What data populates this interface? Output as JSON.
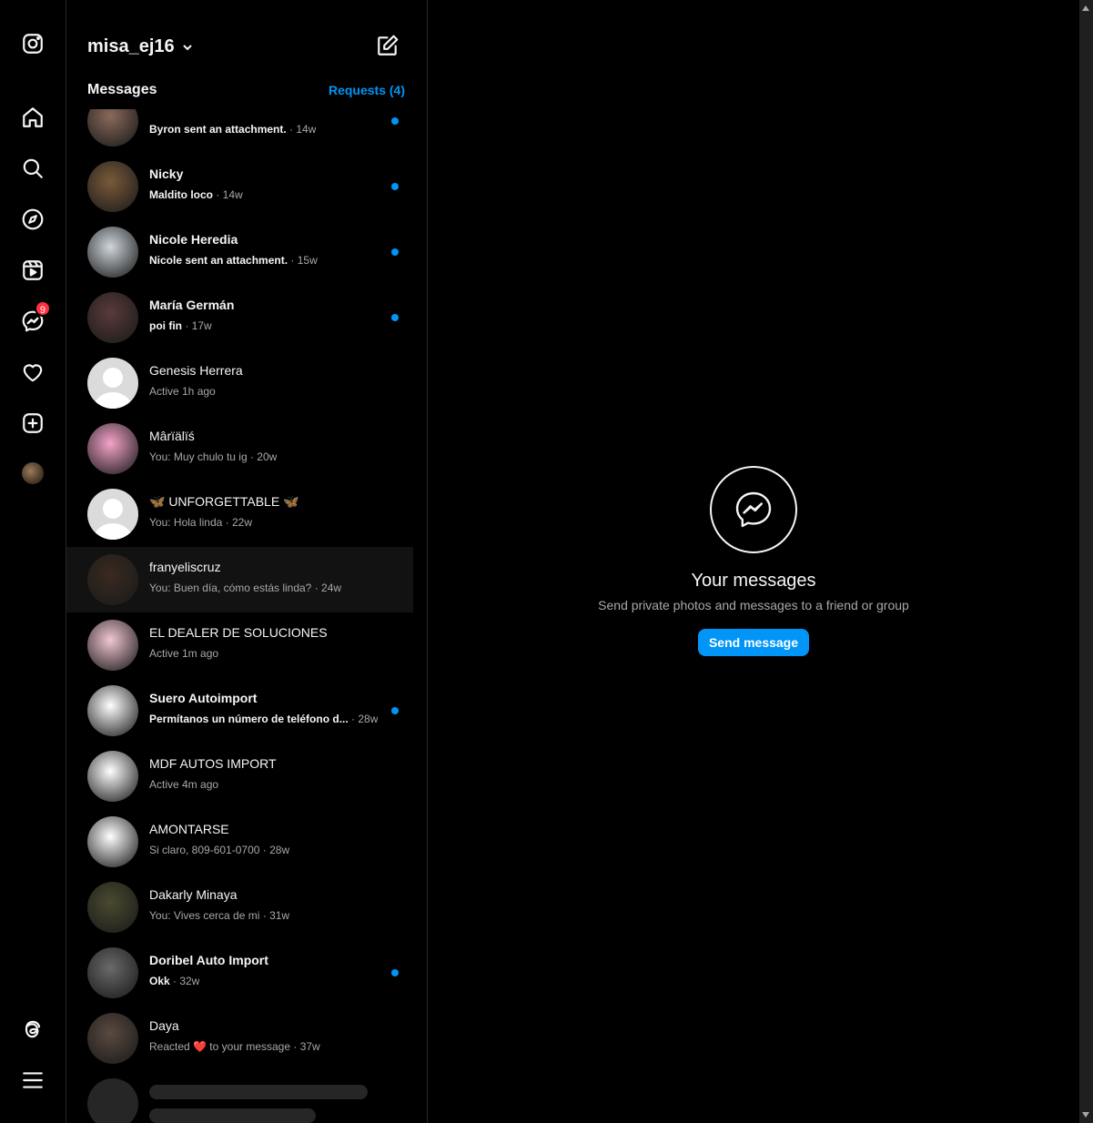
{
  "header": {
    "account_name": "misa_ej16",
    "messages_label": "Messages",
    "requests_label": "Requests (4)"
  },
  "nav": {
    "notification_badge": "9",
    "items": [
      "instagram-logo",
      "home",
      "search",
      "explore",
      "reels",
      "messenger",
      "notifications",
      "create",
      "profile",
      "threads",
      "more"
    ]
  },
  "conversations": [
    {
      "name": "",
      "preview": "Byron sent an attachment.",
      "time": "14w",
      "unread": true,
      "avatar": "#8a6a5a"
    },
    {
      "name": "Nicky",
      "preview": "Maldito loco",
      "time": "14w",
      "unread": true,
      "avatar": "#7a5a3a"
    },
    {
      "name": "Nicole Heredia",
      "preview": "Nicole sent an attachment.",
      "time": "15w",
      "unread": true,
      "avatar": "#cfd6dc"
    },
    {
      "name": "María Germán",
      "preview": "poi fin",
      "time": "17w",
      "unread": true,
      "avatar": "#5a3a3a"
    },
    {
      "name": "Genesis Herrera",
      "preview": "Active 1h ago",
      "time": "",
      "unread": false,
      "avatar": "default"
    },
    {
      "name": "Mârïälïś",
      "preview": "You: Muy chulo tu ig",
      "time": "20w",
      "unread": false,
      "avatar": "#f4a3c9"
    },
    {
      "name": "🦋 UNFORGETTABLE 🦋",
      "preview": "You: Hola linda",
      "time": "22w",
      "unread": false,
      "avatar": "default"
    },
    {
      "name": "franyeliscruz",
      "preview": "You: Buen día, cómo estás linda?",
      "time": "24w",
      "unread": false,
      "avatar": "#3a2a20",
      "selected": true
    },
    {
      "name": "EL DEALER DE SOLUCIONES",
      "preview": "Active 1m ago",
      "time": "",
      "unread": false,
      "avatar": "#f2c6d2"
    },
    {
      "name": "Suero Autoimport",
      "preview": "Permítanos un número de teléfono d...",
      "time": "28w",
      "unread": true,
      "avatar": "#ffffff"
    },
    {
      "name": "MDF AUTOS IMPORT",
      "preview": "Active 4m ago",
      "time": "",
      "unread": false,
      "avatar": "#ffffff"
    },
    {
      "name": "AMONTARSE",
      "preview": "Si claro, 809-601-0700",
      "time": "28w",
      "unread": false,
      "avatar": "#ffffff"
    },
    {
      "name": "Dakarly Minaya",
      "preview": "You: Vives cerca de mi",
      "time": "31w",
      "unread": false,
      "avatar": "#4a4a30"
    },
    {
      "name": "Doribel Auto Import",
      "preview": "Okk",
      "time": "32w",
      "unread": true,
      "avatar": "#6a6a6a"
    },
    {
      "name": "Daya",
      "preview": "Reacted ❤️ to your message",
      "time": "37w",
      "unread": false,
      "avatar": "#5a4a40"
    }
  ],
  "empty_state": {
    "title": "Your messages",
    "subtitle": "Send private photos and messages to a friend or group",
    "button": "Send message"
  },
  "colors": {
    "accent": "#0095f6",
    "badge": "#ff3040",
    "background": "#000000",
    "secondary_text": "#a8a8a8"
  }
}
